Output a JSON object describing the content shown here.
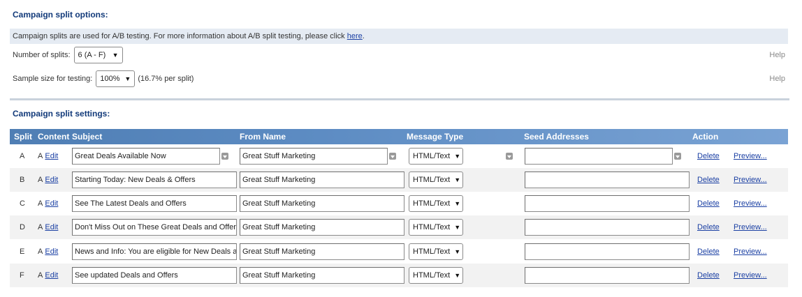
{
  "options": {
    "title": "Campaign split options:",
    "info_text": "Campaign splits are used for A/B testing. For more information about A/B split testing, please click ",
    "info_link": "here",
    "info_suffix": ".",
    "num_splits_label": "Number of splits:",
    "num_splits_value": "6 (A - F)",
    "sample_size_label": "Sample size for testing:",
    "sample_size_value": "100%",
    "per_split_text": "(16.7% per split)",
    "help_label": "Help"
  },
  "settings": {
    "title": "Campaign split settings:",
    "columns": {
      "split": "Split",
      "content": "Content",
      "subject": "Subject",
      "from_name": "From Name",
      "message_type": "Message Type",
      "seed_addresses": "Seed Addresses",
      "action": "Action"
    },
    "rows": [
      {
        "split": "A",
        "content": "A",
        "edit": "Edit",
        "subject": "Great Deals Available Now",
        "from_name": "Great Stuff Marketing",
        "message_type": "HTML/Text",
        "seed": "",
        "delete": "Delete",
        "preview": "Preview..."
      },
      {
        "split": "B",
        "content": "A",
        "edit": "Edit",
        "subject": "Starting Today: New Deals & Offers",
        "from_name": "Great Stuff Marketing",
        "message_type": "HTML/Text",
        "seed": "",
        "delete": "Delete",
        "preview": "Preview..."
      },
      {
        "split": "C",
        "content": "A",
        "edit": "Edit",
        "subject": "See The Latest Deals and Offers",
        "from_name": "Great Stuff Marketing",
        "message_type": "HTML/Text",
        "seed": "",
        "delete": "Delete",
        "preview": "Preview..."
      },
      {
        "split": "D",
        "content": "A",
        "edit": "Edit",
        "subject": "Don't Miss Out on These Great Deals and Offers",
        "from_name": "Great Stuff Marketing",
        "message_type": "HTML/Text",
        "seed": "",
        "delete": "Delete",
        "preview": "Preview..."
      },
      {
        "split": "E",
        "content": "A",
        "edit": "Edit",
        "subject": "News and Info: You are eligible for New Deals and Offers",
        "from_name": "Great Stuff Marketing",
        "message_type": "HTML/Text",
        "seed": "",
        "delete": "Delete",
        "preview": "Preview..."
      },
      {
        "split": "F",
        "content": "A",
        "edit": "Edit",
        "subject": "See updated Deals and Offers",
        "from_name": "Great Stuff Marketing",
        "message_type": "HTML/Text",
        "seed": "",
        "delete": "Delete",
        "preview": "Preview..."
      }
    ]
  },
  "icons": {
    "select_arrow": "triangle-down-icon",
    "copy_down": "copy-down-icon"
  }
}
